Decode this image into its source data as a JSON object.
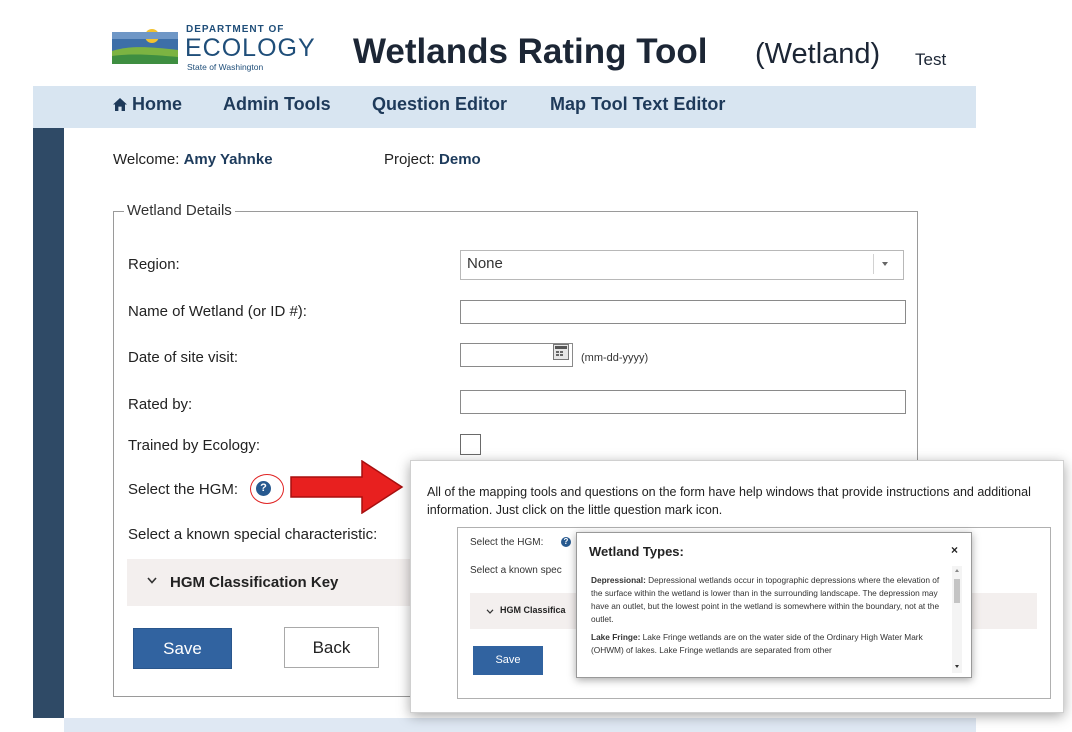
{
  "header": {
    "logo": {
      "dept": "DEPARTMENT OF",
      "name": "ECOLOGY",
      "state": "State of Washington",
      "colors": {
        "blue": "#1f4e79",
        "green": "#7cb342",
        "yellow": "#f2c230"
      }
    },
    "title": "Wetlands Rating Tool",
    "context": "(Wetland)",
    "environment": "Test"
  },
  "nav": {
    "home": "Home",
    "home_icon": "home-icon",
    "admin": "Admin Tools",
    "question_editor": "Question Editor",
    "map_text_editor": "Map Tool Text Editor"
  },
  "welcome": {
    "label": "Welcome:",
    "user": "Amy Yahnke",
    "project_label": "Project:",
    "project": "Demo"
  },
  "form": {
    "legend": "Wetland Details",
    "region_label": "Region:",
    "region_value": "None",
    "name_label": "Name of Wetland (or ID #):",
    "name_value": "",
    "date_label": "Date of site visit:",
    "date_value": "",
    "date_hint": "(mm-dd-yyyy)",
    "rated_label": "Rated by:",
    "rated_value": "",
    "trained_label": "Trained by Ecology:",
    "trained_checked": false,
    "hgm_label": "Select the HGM:",
    "special_label": "Select a known special characteristic:",
    "hgm_key": "HGM Classification Key",
    "save": "Save",
    "back": "Back"
  },
  "callout": {
    "text": "All of the mapping tools and questions on the form have help windows that provide instructions and additional information. Just click on the little question mark icon.",
    "mini_hgm_label": "Select the HGM:",
    "mini_special_label": "Select a known spec",
    "mini_hgm_key": "HGM Classifica",
    "mini_save": "Save",
    "popup": {
      "title": "Wetland Types:",
      "close": "×",
      "p1_term": "Depressional:",
      "p1": " Depressional wetlands occur in topographic depressions where the elevation of the surface within the wetland is lower than in the surrounding landscape. The depression may have an outlet, but the lowest point in the wetland is somewhere within the boundary, not at the outlet.",
      "p2_term": "Lake Fringe:",
      "p2": " Lake Fringe wetlands are on the water side of the Ordinary High Water Mark (OHWM) of lakes. Lake Fringe wetlands are separated from other"
    }
  },
  "colors": {
    "nav_bg": "#d8e5f1",
    "rail": "#2f4a66",
    "primary_button": "#3163a0",
    "highlight": "#e02424",
    "arrow_red": "#e8201f"
  }
}
